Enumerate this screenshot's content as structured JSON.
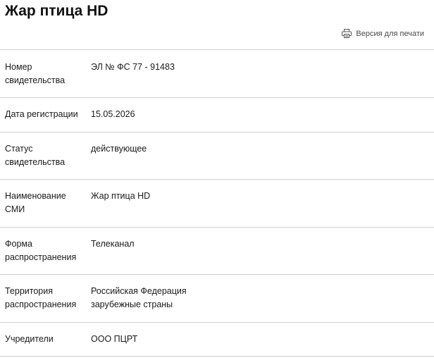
{
  "page": {
    "title": "Жар птица HD",
    "print_link": {
      "label": "Версия для печати",
      "icon": "printer-icon"
    }
  },
  "rows": [
    {
      "label_lines": [
        "Номер",
        "свидетельства"
      ],
      "value_lines": [
        "ЭЛ № ФС 77 - 91483"
      ]
    },
    {
      "label_lines": [
        "Дата регистрации"
      ],
      "value_lines": [
        "15.05.2026"
      ]
    },
    {
      "label_lines": [
        "Статус",
        "свидетельства"
      ],
      "value_lines": [
        "действующее"
      ]
    },
    {
      "label_lines": [
        "Наименование",
        "СМИ"
      ],
      "value_lines": [
        "Жар птица HD"
      ]
    },
    {
      "label_lines": [
        "Форма",
        "распространения"
      ],
      "value_lines": [
        "Телеканал"
      ]
    },
    {
      "label_lines": [
        "Территория",
        "распространения"
      ],
      "value_lines": [
        "Российская Федерация",
        "зарубежные страны"
      ]
    },
    {
      "label_lines": [
        "Учредители"
      ],
      "value_lines": [
        "ООО ПЦРТ"
      ]
    }
  ]
}
